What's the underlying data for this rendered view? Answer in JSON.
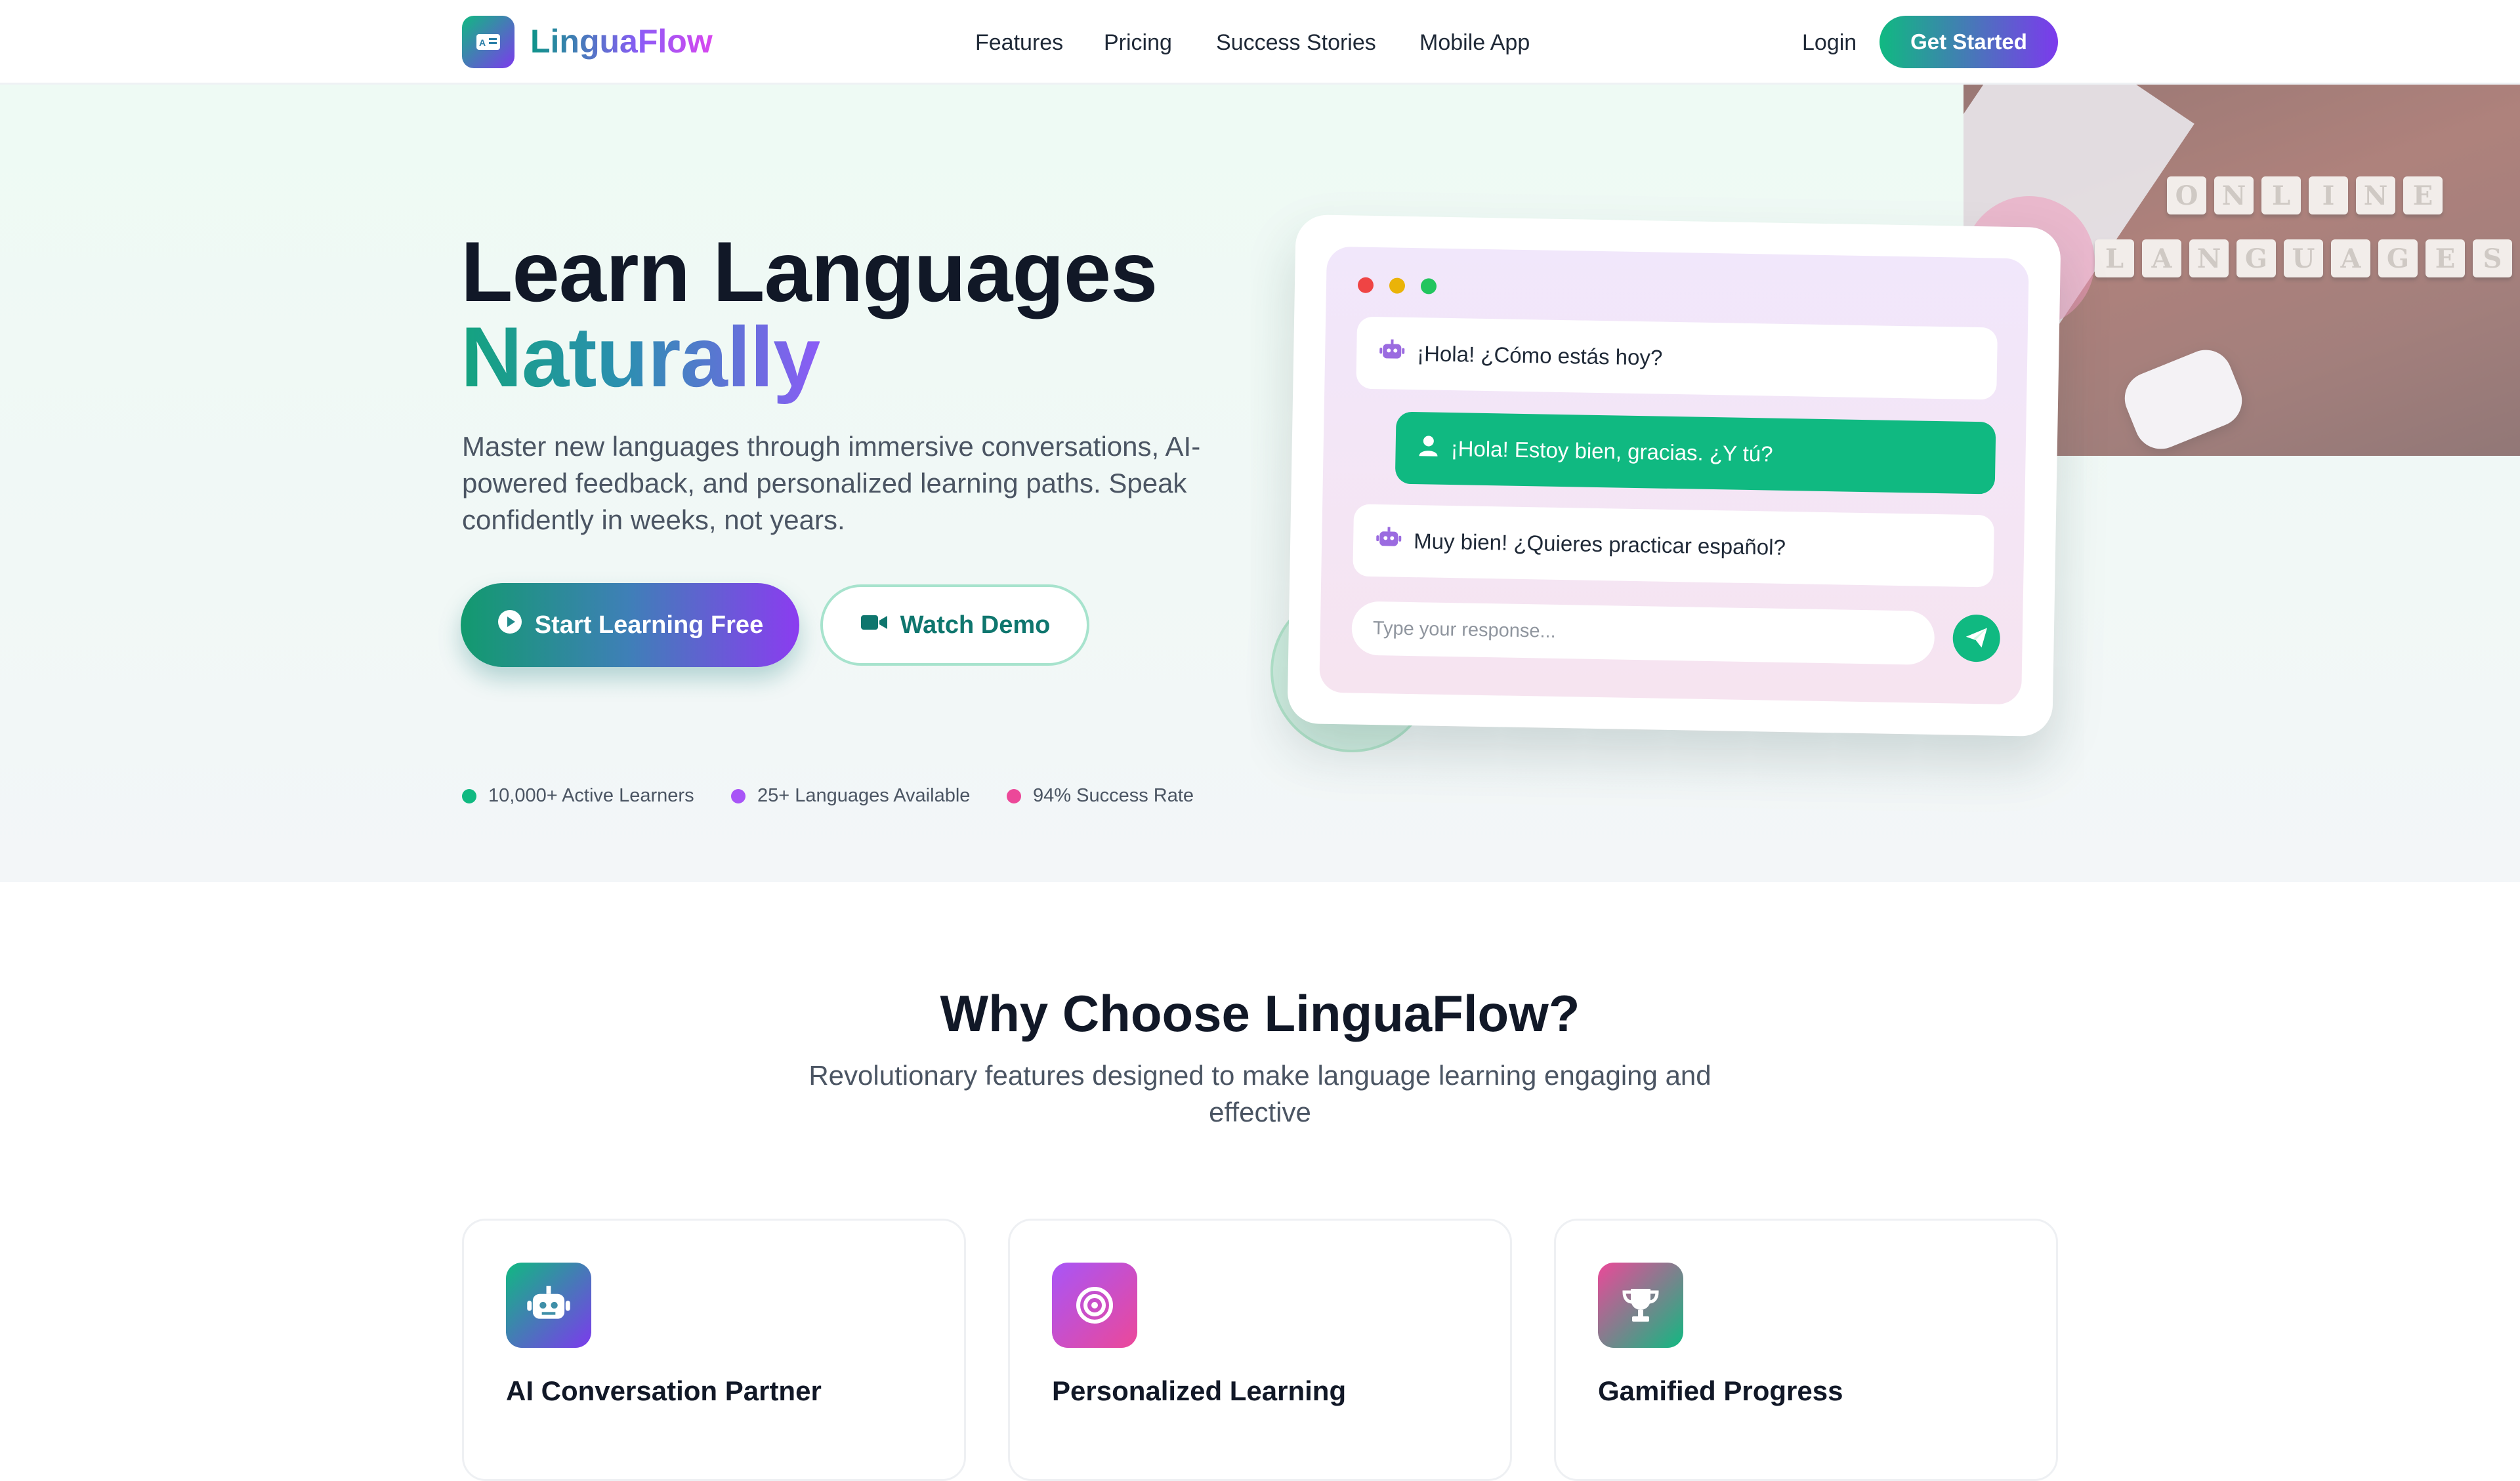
{
  "brand": {
    "name": "LinguaFlow",
    "logo_icon": "language-card-icon",
    "gradient": [
      "#10b981",
      "#7c3aed"
    ]
  },
  "nav": {
    "links": [
      "Features",
      "Pricing",
      "Success Stories",
      "Mobile App"
    ],
    "login": "Login",
    "cta": "Get Started"
  },
  "hero": {
    "title_line1": "Learn Languages",
    "title_line2": "Naturally",
    "subtitle": "Master new languages through immersive conversations, AI-powered feedback, and personalized learning paths. Speak confidently in weeks, not years.",
    "primary_button": "Start Learning Free",
    "primary_icon": "play-circle-icon",
    "secondary_button": "Watch Demo",
    "secondary_icon": "video-camera-icon",
    "stats": [
      {
        "label": "10,000+ Active Learners",
        "color": "#10b981"
      },
      {
        "label": "25+ Languages Available",
        "color": "#a855f7"
      },
      {
        "label": "94% Success Rate",
        "color": "#ec4899"
      }
    ],
    "photo_tiles": {
      "row1": [
        "O",
        "N",
        "L",
        "I",
        "N",
        "E"
      ],
      "row2": [
        "L",
        "A",
        "N",
        "G",
        "U",
        "A",
        "G",
        "E",
        "S"
      ]
    }
  },
  "chat": {
    "messages": [
      {
        "from": "bot",
        "icon": "robot-icon",
        "text": "¡Hola! ¿Cómo estás hoy?"
      },
      {
        "from": "user",
        "icon": "user-icon",
        "text": "¡Hola! Estoy bien, gracias. ¿Y tú?"
      },
      {
        "from": "bot",
        "icon": "robot-icon",
        "text": "Muy bien! ¿Quieres practicar español?"
      }
    ],
    "input_placeholder": "Type your response...",
    "send_icon": "paper-plane-icon",
    "window_dots": [
      "#ef4444",
      "#eab308",
      "#22c55e"
    ]
  },
  "features": {
    "title": "Why Choose LinguaFlow?",
    "subtitle": "Revolutionary features designed to make language learning engaging and effective",
    "cards": [
      {
        "title": "AI Conversation Partner",
        "icon": "robot-icon"
      },
      {
        "title": "Personalized Learning",
        "icon": "target-icon"
      },
      {
        "title": "Gamified Progress",
        "icon": "trophy-icon"
      }
    ]
  }
}
